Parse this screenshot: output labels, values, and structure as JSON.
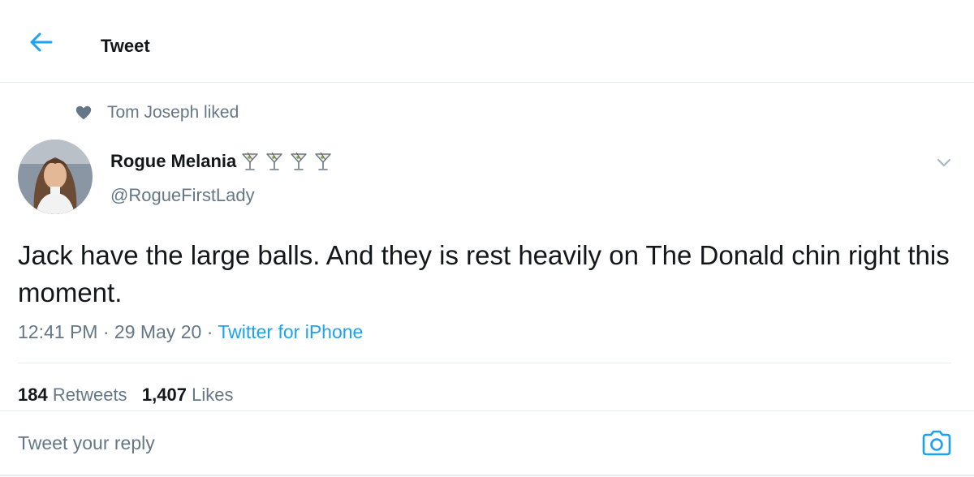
{
  "header": {
    "title": "Tweet",
    "back_icon": "arrow-left-icon"
  },
  "social_context": {
    "icon": "heart-icon",
    "text": "Tom Joseph liked"
  },
  "tweet": {
    "author": {
      "name": "Rogue Melania",
      "handle": "@RogueFirstLady",
      "name_emoji": [
        "martini-glass-icon",
        "martini-glass-icon",
        "martini-glass-icon",
        "martini-glass-icon"
      ]
    },
    "text": "Jack have the large balls. And they is rest heavily on The Donald chin right this moment.",
    "time": "12:41 PM",
    "separator": "·",
    "date": "29 May 20",
    "source": "Twitter for iPhone",
    "stats": {
      "retweets_count": "184",
      "retweets_label": "Retweets",
      "likes_count": "1,407",
      "likes_label": "Likes"
    }
  },
  "reply": {
    "placeholder": "Tweet your reply",
    "camera_icon": "camera-icon"
  },
  "colors": {
    "accent": "#1da1f2",
    "secondary_text": "#657786",
    "primary_text": "#14171a",
    "divider": "#e6ecf0"
  }
}
